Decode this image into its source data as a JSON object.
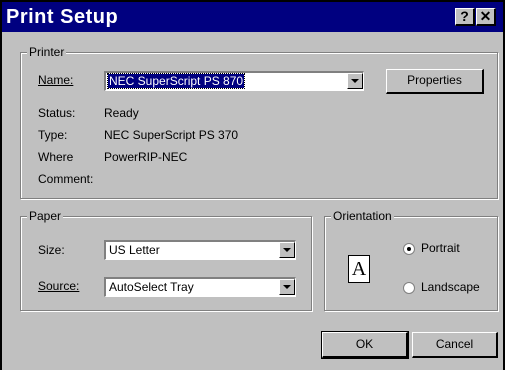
{
  "window": {
    "title": "Print Setup",
    "help_label": "?",
    "close_label": "✕"
  },
  "printer": {
    "group_label": "Printer",
    "name_label": "Name:",
    "name_value": "NEC SuperScript PS 870",
    "properties_label": "Properties",
    "status_label": "Status:",
    "status_value": "Ready",
    "type_label": "Type:",
    "type_value": "NEC SuperScript PS 370",
    "where_label": "Where",
    "where_value": "PowerRIP-NEC",
    "comment_label": "Comment:",
    "comment_value": ""
  },
  "paper": {
    "group_label": "Paper",
    "size_label": "Size:",
    "size_value": "US Letter",
    "source_label": "Source:",
    "source_value": "AutoSelect Tray"
  },
  "orientation": {
    "group_label": "Orientation",
    "icon_letter": "A",
    "portrait_label": "Portrait",
    "landscape_label": "Landscape",
    "selected": "Portrait"
  },
  "buttons": {
    "ok_label": "OK",
    "cancel_label": "Cancel"
  }
}
